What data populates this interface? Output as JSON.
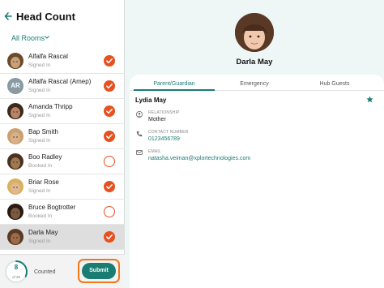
{
  "header": {
    "title": "Head Count"
  },
  "filter": {
    "rooms_label": "All Rooms"
  },
  "children": [
    {
      "name": "Alfalfa Rascal",
      "status": "Signed In",
      "checked": true,
      "avatar": "photo",
      "selected": false
    },
    {
      "name": "Alfalfa Rascal (Amep)",
      "status": "Signed In",
      "checked": true,
      "avatar": "AR",
      "selected": false
    },
    {
      "name": "Amanda Thripp",
      "status": "Signed In",
      "checked": true,
      "avatar": "photo",
      "selected": false
    },
    {
      "name": "Bap Smith",
      "status": "Signed In",
      "checked": true,
      "avatar": "photo",
      "selected": false
    },
    {
      "name": "Boo Radley",
      "status": "Booked In",
      "checked": false,
      "avatar": "photo",
      "selected": false
    },
    {
      "name": "Briar Rose",
      "status": "Signed In",
      "checked": true,
      "avatar": "photo",
      "selected": false
    },
    {
      "name": "Bruce Bogtrotter",
      "status": "Booked In",
      "checked": false,
      "avatar": "photo",
      "selected": false
    },
    {
      "name": "Darla May",
      "status": "Signed In",
      "checked": true,
      "avatar": "photo",
      "selected": true
    }
  ],
  "footer": {
    "count": "8",
    "of_total": "of 25",
    "progress": 0.32,
    "counted_label": "Counted",
    "submit_label": "Submit"
  },
  "profile": {
    "name": "Darla May",
    "tabs": [
      "Parent/Guardian",
      "Emergency",
      "Hub Guests"
    ],
    "active_tab": 0,
    "guardian_name": "Lydia May",
    "relationship_label": "RELATIONSHIP",
    "relationship_value": "Mother",
    "contact_label": "CONTACT NUMBER",
    "contact_value": "0123456789",
    "email_label": "EMAIL",
    "email_value": "natasha.veiman@xplortechnologies.com"
  },
  "colors": {
    "accent": "#1a7d74",
    "check": "#e5511f",
    "highlight": "#f07818"
  },
  "icons": [
    "back-arrow-icon",
    "chevron-down-icon",
    "check-icon",
    "star-icon",
    "person-icon",
    "phone-icon",
    "mail-icon"
  ]
}
